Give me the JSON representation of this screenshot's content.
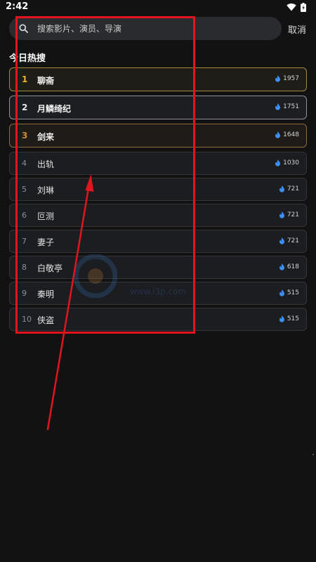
{
  "status_bar": {
    "time": "2:42"
  },
  "search": {
    "placeholder": "搜索影片、演员、导演",
    "cancel_label": "取消"
  },
  "section_title": "今日热搜",
  "hot_list": [
    {
      "rank": "1",
      "title": "聊斋",
      "heat": "1957"
    },
    {
      "rank": "2",
      "title": "月鳞绮纪",
      "heat": "1751"
    },
    {
      "rank": "3",
      "title": "剑来",
      "heat": "1648"
    },
    {
      "rank": "4",
      "title": "出轨",
      "heat": "1030"
    },
    {
      "rank": "5",
      "title": "刘琳",
      "heat": "721"
    },
    {
      "rank": "6",
      "title": "叵测",
      "heat": "721"
    },
    {
      "rank": "7",
      "title": "妻子",
      "heat": "721"
    },
    {
      "rank": "8",
      "title": "白敬亭",
      "heat": "618"
    },
    {
      "rank": "9",
      "title": "秦明",
      "heat": "515"
    },
    {
      "rank": "10",
      "title": "侠盗",
      "heat": "515"
    }
  ],
  "watermark": {
    "text": "www.i3p.com"
  },
  "icons": {
    "search": "search-icon",
    "flame": "flame-icon",
    "wifi": "wifi-icon",
    "battery": "battery-icon"
  },
  "colors": {
    "background": "#121212",
    "rank_1": "#f0b323",
    "rank_2": "#e9e9e9",
    "rank_3": "#d08a37",
    "flame": "#3d8ff5",
    "annotation": "#e0151e"
  }
}
